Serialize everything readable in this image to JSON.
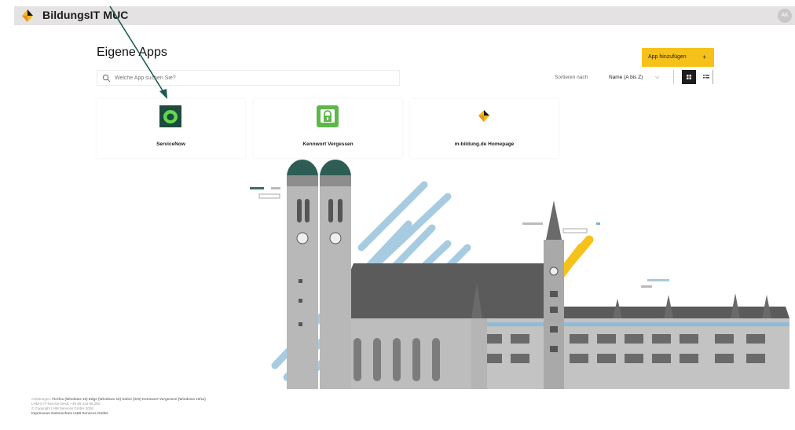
{
  "header": {
    "brand": "BildungsIT MUC",
    "avatar_initials": "AK",
    "logo_icon": "diamond-logo-icon"
  },
  "main": {
    "title": "Eigene Apps",
    "add_button_label": "App hinzufügen",
    "add_button_plus": "+",
    "search_placeholder": "Welche App suchen Sie?",
    "sort_label": "Sortieren nach",
    "sort_value": "Name (A bis Z)",
    "sort_chevron": "⌵",
    "view_modes": [
      "grid-view-icon",
      "list-view-icon"
    ]
  },
  "apps": [
    {
      "label": "ServiceNow",
      "icon": "servicenow-icon"
    },
    {
      "label": "Kennwort Vergessen",
      "icon": "password-lock-icon"
    },
    {
      "label": "m-bildung.de Homepage",
      "icon": "m-bildung-logo-icon"
    }
  ],
  "footer": {
    "line1_prefix": "Anleitungen:",
    "line1_links": "Firefox (Windows 10) Edge (Windows 10) Safari (iOS) Kennwort Vergessen (Windows 10/11)",
    "line2": "LHM-S IT-Service Desk: +49 89 233 96 260",
    "line3": "© Copyright LHM Services GmbH 2026.",
    "line4": "Impressum Datenschutz LHM Services GmbH"
  },
  "colors": {
    "accent": "#f6c21a",
    "topbar": "#e4e2e3",
    "servicenow": "#1f4a3e",
    "password": "#5fb74a",
    "arrow": "#1b5a52"
  }
}
